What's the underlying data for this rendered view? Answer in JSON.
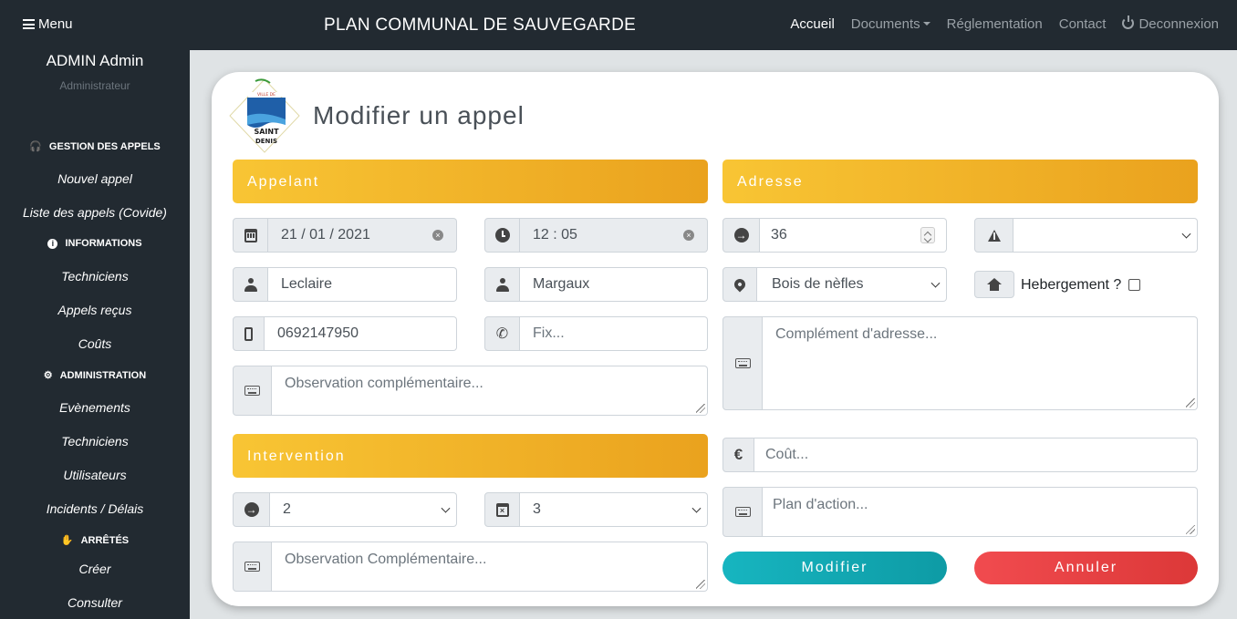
{
  "topbar": {
    "menu_label": "Menu",
    "brand": "PLAN COMMUNAL DE SAUVEGARDE",
    "nav": {
      "accueil": "Accueil",
      "documents": "Documents",
      "reglementation": "Réglementation",
      "contact": "Contact",
      "deconnexion": "Deconnexion"
    }
  },
  "sidebar": {
    "user_name": "ADMIN Admin",
    "user_role": "Administrateur",
    "sections": {
      "gestion": "GESTION DES APPELS",
      "informations": "INFORMATIONS",
      "administration": "ADMINISTRATION",
      "arretes": "ARRÊTÉS"
    },
    "items": {
      "nouvel_appel": "Nouvel appel",
      "liste_appels": "Liste des appels (Covide)",
      "techniciens_info": "Techniciens",
      "appels_recus": "Appels reçus",
      "couts": "Coûts",
      "evenements": "Evènements",
      "techniciens_admin": "Techniciens",
      "utilisateurs": "Utilisateurs",
      "incidents": "Incidents / Délais",
      "creer": "Créer",
      "consulter": "Consulter"
    }
  },
  "logo": {
    "top_text": "VILLE DE",
    "line1": "SAINT",
    "line2": "DENIS"
  },
  "page_title": "Modifier un appel",
  "appelant": {
    "header": "Appelant",
    "date": "21 / 01 / 2021",
    "time": "12 : 05",
    "nom": "Leclaire",
    "prenom": "Margaux",
    "mobile": "0692147950",
    "fixe_placeholder": "Fix...",
    "observation_placeholder": "Observation complémentaire..."
  },
  "intervention": {
    "header": "Intervention",
    "select1": "2",
    "select2": "3",
    "observation_placeholder": "Observation Complémentaire..."
  },
  "adresse": {
    "header": "Adresse",
    "numero": "36",
    "voie": "",
    "quartier": "Bois de nèfles",
    "hebergement_label": "Hebergement ?",
    "complement_placeholder": "Complément d'adresse...",
    "cout_placeholder": "Coût...",
    "plan_placeholder": "Plan d'action..."
  },
  "buttons": {
    "modifier": "Modifier",
    "annuler": "Annuler"
  },
  "colors": {
    "band_start": "#f8c534",
    "band_end": "#eaa21e",
    "modifier": "#17b5c0",
    "annuler": "#f14b4f",
    "dark": "#222a31"
  }
}
